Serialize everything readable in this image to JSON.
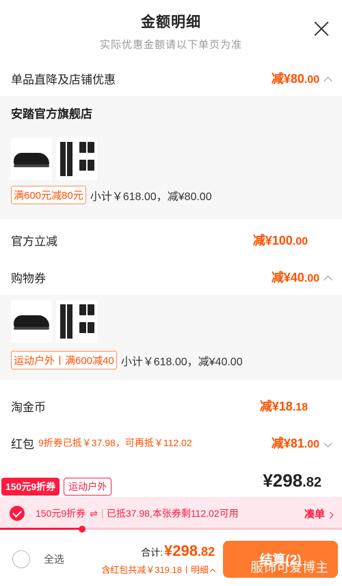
{
  "header": {
    "title": "金额明细",
    "subtitle": "实际优惠金额请以下单页为准"
  },
  "discount_section": {
    "label": "单品直降及店铺优惠",
    "amount_prefix": "减¥80",
    "amount_decimal": ".00"
  },
  "store1": {
    "name": "安踏官方旗舰店",
    "badge": "满600元减80元",
    "subtotal": "小计￥618.00，减¥80.00"
  },
  "official_discount": {
    "label": "官方立减",
    "amount_prefix": "减¥100",
    "amount_decimal": ".00"
  },
  "shopping_coupon": {
    "label": "购物券",
    "amount_prefix": "减¥40",
    "amount_decimal": ".00"
  },
  "store2": {
    "badge": "运动户外丨满600减40",
    "subtotal": "小计￥618.00，减¥40.00"
  },
  "taojinbi": {
    "label": "淘金币",
    "amount_prefix": "减¥18",
    "amount_decimal": ".18"
  },
  "hongbao": {
    "label": "红包",
    "note": "9折券已抵￥37.98，可再抵￥112.02",
    "amount_prefix": "减¥81",
    "amount_decimal": ".00"
  },
  "coupon_tags": {
    "primary": "150元9折券",
    "secondary": "运动户外"
  },
  "price": {
    "int": "¥298",
    "dec": ".82"
  },
  "coupon_bar": {
    "name": "150元9折券",
    "swap": "⇌",
    "info": "已抵37.98,本张券剩112.02可用",
    "link": "凑单"
  },
  "progress": {
    "fraction": 0.24
  },
  "bottom": {
    "select_all": "全选",
    "total_label": "合计:",
    "total_int": "¥298",
    "total_dec": ".82",
    "total_sub": "含红包共减￥319.18丨",
    "detail": "明细",
    "checkout": "结算(2)"
  },
  "watermark": "服饰可爱博主",
  "colors": {
    "accent": "#ff5000",
    "coupon_red": "#ff1a3e",
    "checkout": "#ff7a2e"
  }
}
